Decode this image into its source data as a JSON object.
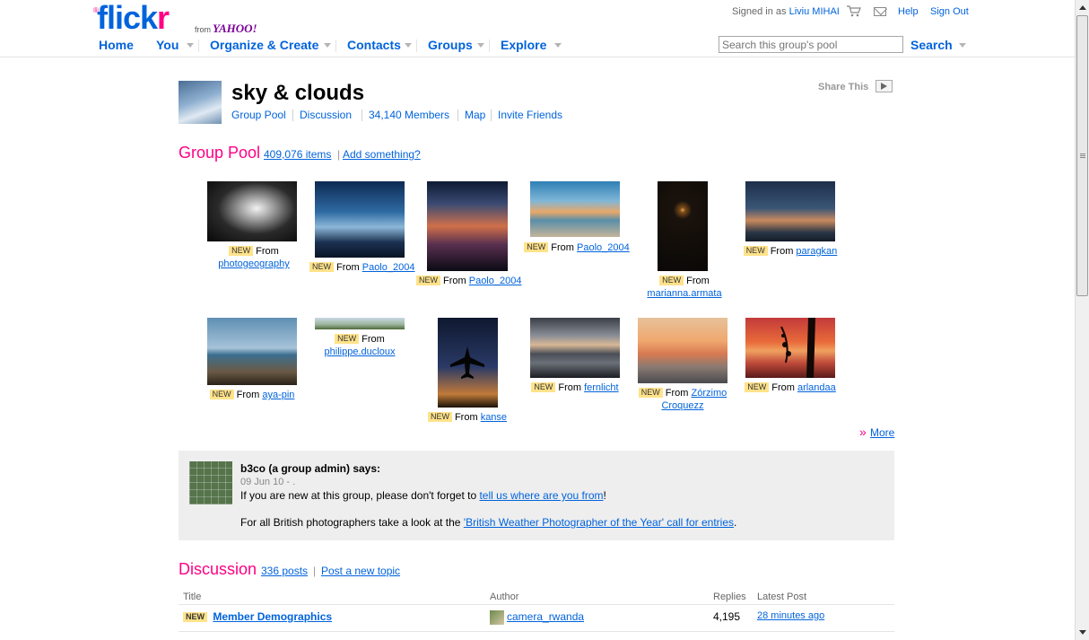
{
  "header": {
    "logo_text_main": "flickr",
    "logo_from": "from",
    "logo_yahoo": "YAHOO!",
    "signed_in_prefix": "Signed in as",
    "username": "Liviu MIHAI",
    "help": "Help",
    "sign_out": "Sign Out",
    "nav": [
      "Home",
      "You",
      "Organize & Create",
      "Contacts",
      "Groups",
      "Explore"
    ],
    "search_placeholder": "Search this group's pool",
    "search_button": "Search"
  },
  "group": {
    "title": "sky & clouds",
    "nav": [
      "Group Pool",
      "Discussion",
      "34,140 Members",
      "Map",
      "Invite Friends"
    ],
    "share": "Share This"
  },
  "pool": {
    "title": "Group Pool",
    "count": "409,076 items",
    "add": "Add something?",
    "new_badge": "NEW",
    "from": "From",
    "more": "More",
    "photos": [
      {
        "user": "photogeography",
        "user2": ""
      },
      {
        "user": "Paolo_2004",
        "user2": ""
      },
      {
        "user": "Paolo_2004",
        "user2": ""
      },
      {
        "user": "Paolo_2004",
        "user2": ""
      },
      {
        "user": "marianna.armata",
        "user2": ""
      },
      {
        "user": "paragkan",
        "user2": ""
      },
      {
        "user": "aya-pin",
        "user2": ""
      },
      {
        "user": "philippe.ducloux",
        "user2": ""
      },
      {
        "user": "kanse",
        "user2": ""
      },
      {
        "user": "fernlicht",
        "user2": ""
      },
      {
        "user": "Zórzimo",
        "user2": "Croquezz"
      },
      {
        "user": "arlandaa",
        "user2": ""
      }
    ]
  },
  "admin_note": {
    "name": "b3co (a group admin) says:",
    "date": "09 Jun 10 - .",
    "line1_prefix": "If you are new at this group, please don't forget to ",
    "line1_link": "tell us where are you from",
    "line1_suffix": "!",
    "line2_prefix": "For all British photographers take a look at the ",
    "line2_link": "'British Weather Photographer of the Year' call for entries",
    "line2_suffix": "."
  },
  "discussion": {
    "title": "Discussion",
    "posts": "336 posts",
    "new_topic": "Post a new topic",
    "columns": [
      "Title",
      "Author",
      "Replies",
      "Latest Post"
    ],
    "rows": [
      {
        "badge": "NEW",
        "title": "Member Demographics",
        "author": "camera_rwanda",
        "replies": "4,195",
        "latest": "28 minutes ago"
      }
    ]
  },
  "colors": {
    "link": "#0063dc",
    "accent": "#ff0084",
    "badge": "#ffe28a"
  }
}
